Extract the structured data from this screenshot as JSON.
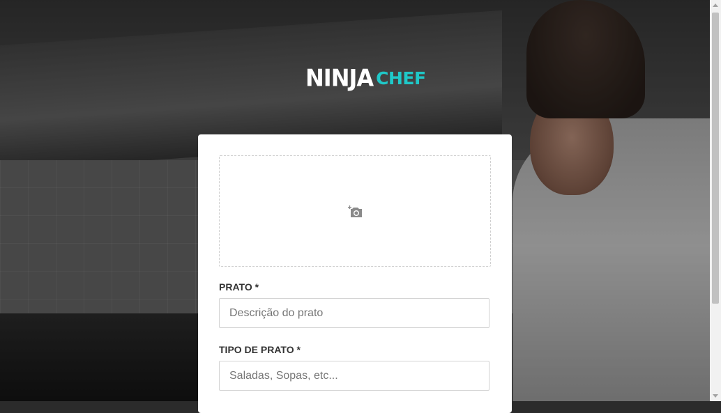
{
  "brand": {
    "logo_word_1": "NINJA",
    "logo_word_2": "CHEF",
    "accent_color": "#1fc8c8"
  },
  "form": {
    "upload": {
      "icon": "add-photo-icon"
    },
    "fields": [
      {
        "label": "PRATO *",
        "placeholder": "Descrição do prato",
        "value": ""
      },
      {
        "label": "TIPO DE PRATO *",
        "placeholder": "Saladas, Sopas, etc...",
        "value": ""
      }
    ]
  }
}
